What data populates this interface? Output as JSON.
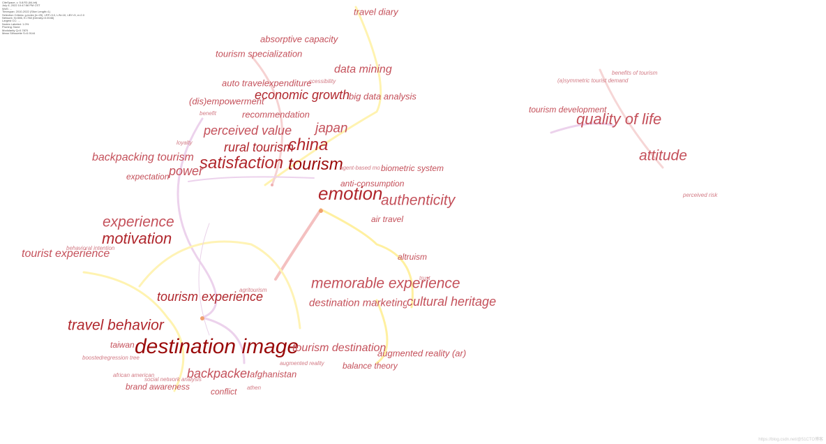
{
  "info_lines": [
    "CiteSpace, v. 5.8.R3 (64-bit)",
    "July 6, 2022 10:47:56 PM CST",
    "WoS: ...",
    "Timespan: 2010-2022 (Slice Length=1)",
    "Selection Criteria: g-index (k=25), LRF=3.0, L/N=10, LBY=5, e=2.0",
    "Network: N=586, E=788 (Density=0.0046)",
    "Largest CC: ...",
    "Nodes Labeled: 1.0%",
    "Pruning: None",
    "Modularity Q=0.7870",
    "Mean Silhouette S=0.9144"
  ],
  "watermark": "https://blog.csdn.net/@51CTO博客",
  "keywords": [
    "travel diary",
    "absorptive capacity",
    "tourism specialization",
    "data mining",
    "auto travelexpenditure",
    "ccessibility",
    "economic growth",
    "big data analysis",
    "(dis)empowerment",
    "benefit",
    "recommendation",
    "perceived value",
    "japan",
    "rural tourism",
    "china",
    "loyalty",
    "backpacking tourism",
    "satisfaction",
    "tourism",
    "agent-based mo",
    "biometric system",
    "power",
    "expectation",
    "anti-consumption",
    "emotion",
    "authenticity",
    "air travel",
    "experience",
    "motivation",
    "behavioral intention",
    "tourist experience",
    "altruism",
    "trust",
    "memorable experience",
    "agritourism",
    "tourism experience",
    "destination marketing",
    "cultural heritage",
    "travel behavior",
    "taiwan",
    "destination image",
    "tourism destination",
    "augmented reality (ar)",
    "boostedregression tree",
    "augmented reality",
    "balance theory",
    "backpacker",
    "afghanistan",
    "african american",
    "social network analysis",
    "brand awareness",
    "athen",
    "conflict",
    "benefits of tourism",
    "(a)symmetric tourist demand",
    "tourism development",
    "quality of life",
    "attitude",
    "perceived risk"
  ],
  "colors": {
    "label_dark": "#9a0a0a",
    "label_mid": "#c4505a",
    "edge_yellow": "#fff2a0",
    "edge_pink": "#f4c8c8",
    "edge_purple": "#e6cce6"
  }
}
